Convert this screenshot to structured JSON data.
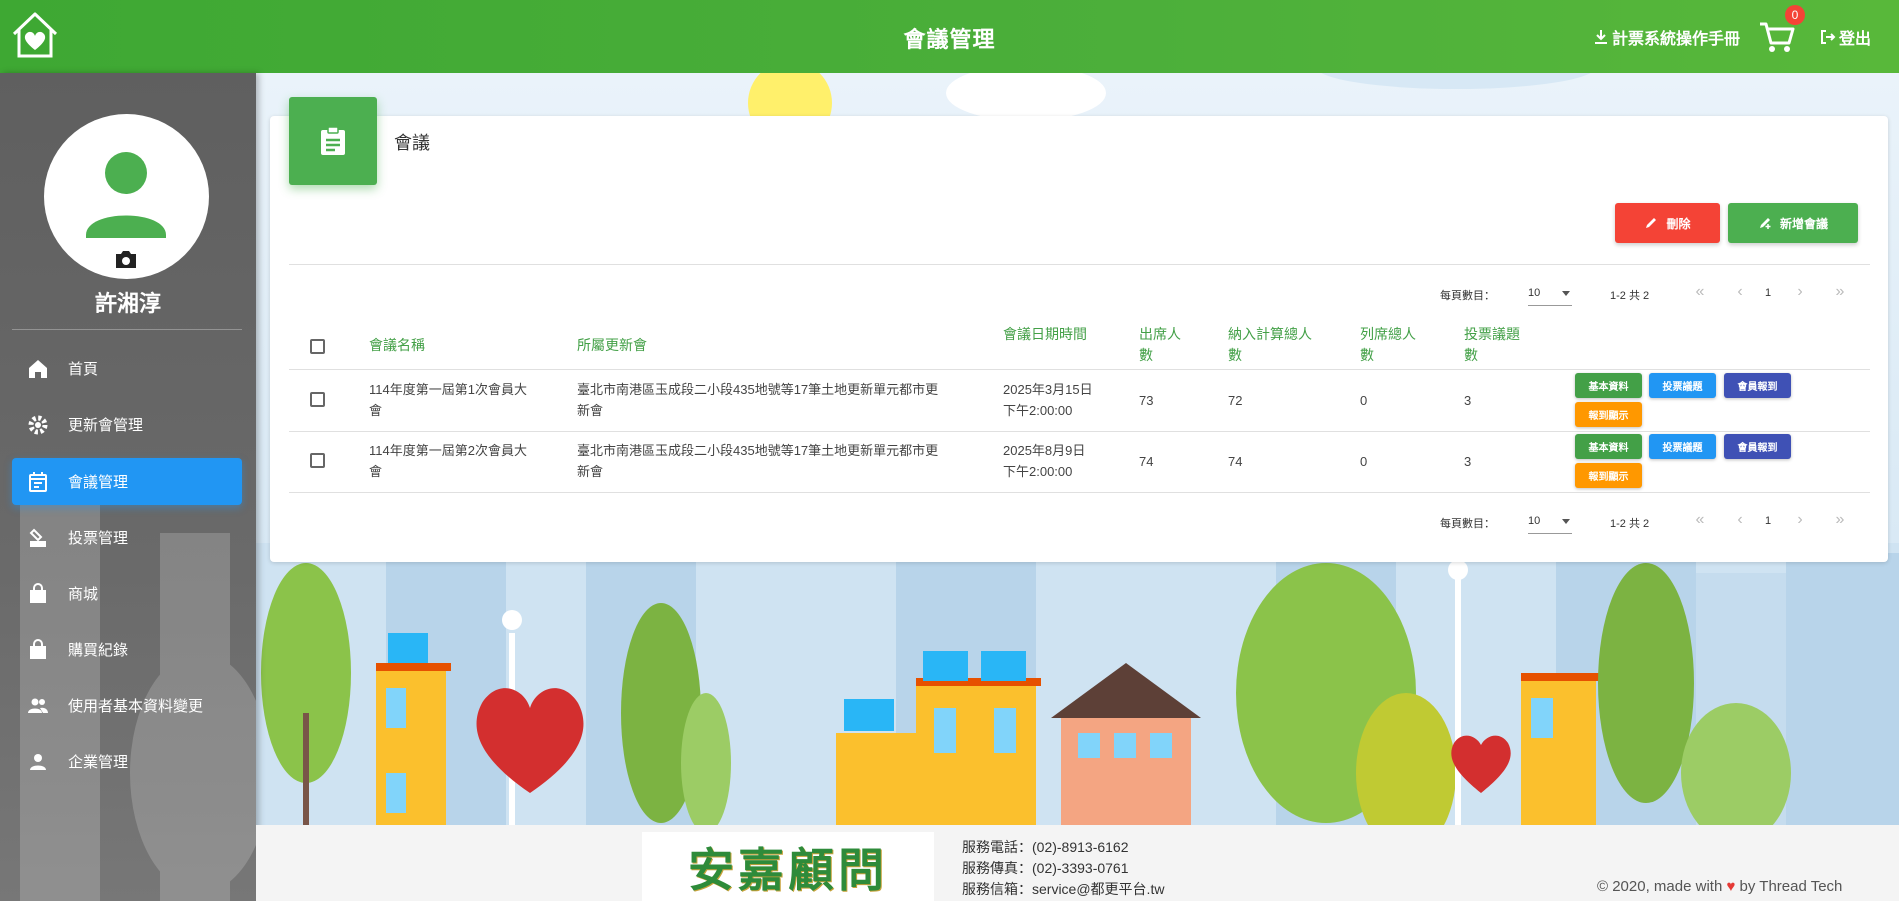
{
  "header": {
    "title": "會議管理",
    "manual_label": "計票系統操作手冊",
    "cart_count": "0",
    "logout_label": "登出"
  },
  "sidebar": {
    "username": "許湘淳",
    "items": [
      {
        "label": "首頁",
        "icon": "home-icon"
      },
      {
        "label": "更新會管理",
        "icon": "gear-icon"
      },
      {
        "label": "會議管理",
        "icon": "calendar-icon",
        "active": true
      },
      {
        "label": "投票管理",
        "icon": "ballot-icon"
      },
      {
        "label": "商城",
        "icon": "shopping-bag-icon"
      },
      {
        "label": "購買紀錄",
        "icon": "shopping-bag-icon"
      },
      {
        "label": "使用者基本資料變更",
        "icon": "people-icon"
      },
      {
        "label": "企業管理",
        "icon": "person-icon"
      }
    ]
  },
  "card": {
    "title": "會議",
    "delete_label": "刪除",
    "add_label": "新增會議"
  },
  "pagination": {
    "per_page_label": "每頁數目：",
    "per_page_value": "10",
    "range": "1-2 共 2",
    "page": "1"
  },
  "table": {
    "headers": {
      "name": "會議名稱",
      "assoc": "所屬更新會",
      "datetime": "會議日期時間",
      "attend_1": "出席人",
      "attend_2": "數",
      "total_1": "納入計算總人",
      "total_2": "數",
      "observer_1": "列席總人",
      "observer_2": "數",
      "topics_1": "投票議題",
      "topics_2": "數"
    },
    "rows": [
      {
        "name_1": "114年度第一屆第1次會員大",
        "name_2": "會",
        "assoc_1": "臺北市南港區玉成段二小段435地號等17筆土地更新單元都市更",
        "assoc_2": "新會",
        "date": "2025年3月15日",
        "time": "下午2:00:00",
        "attend": "73",
        "total": "72",
        "observer": "0",
        "topics": "3"
      },
      {
        "name_1": "114年度第一屆第2次會員大",
        "name_2": "會",
        "assoc_1": "臺北市南港區玉成段二小段435地號等17筆土地更新單元都市更",
        "assoc_2": "新會",
        "date": "2025年8月9日",
        "time": "下午2:00:00",
        "attend": "74",
        "total": "74",
        "observer": "0",
        "topics": "3"
      }
    ],
    "actions": {
      "basic": "基本資料",
      "vote": "投票議題",
      "member": "會員報到",
      "show": "報到顯示"
    }
  },
  "footer": {
    "logo_text": "安嘉顧問",
    "phone": "服務電話：(02)-8913-6162",
    "fax": "服務傳真：(02)-3393-0761",
    "email": "服務信箱：service@都更平台.tw",
    "copyright_pre": "© 2020, made with",
    "copyright_post": "by Thread Tech"
  },
  "colors": {
    "header_green": "#4caf3a",
    "primary_blue": "#2196f3",
    "delete_red": "#f44336",
    "add_green": "#4caf50",
    "member_indigo": "#3f51b5",
    "show_orange": "#ff9800"
  }
}
